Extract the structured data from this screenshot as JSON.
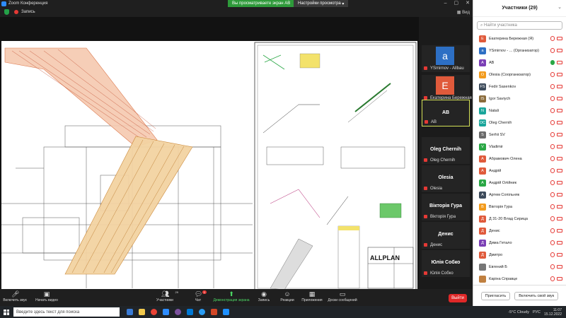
{
  "window": {
    "title": "Zoom Конференция",
    "share_banner": "Вы просматриваете экран AB",
    "view_options": "Настройки просмотра",
    "recording_label": "Запись",
    "view_label": "Вид"
  },
  "gallery": [
    {
      "type": "avatar",
      "letter": "a",
      "color": "#2d6fc4",
      "name": "YSmirnov - Allbau"
    },
    {
      "type": "avatar",
      "letter": "E",
      "color": "#e05a3b",
      "name": "Екатерина Бережная"
    },
    {
      "type": "active",
      "big_name": "AB",
      "name": "AB"
    },
    {
      "type": "name",
      "big_name": "Oleg Chernih",
      "name": "Oleg Chernih"
    },
    {
      "type": "name",
      "big_name": "Olesia",
      "name": "Olesia"
    },
    {
      "type": "name",
      "big_name": "Вікторія Гура",
      "name": "Вікторія Гура"
    },
    {
      "type": "name",
      "big_name": "Денис",
      "name": "Денис"
    },
    {
      "type": "name",
      "big_name": "Юлія Собко",
      "name": "Юлія Собко"
    }
  ],
  "toolbar": {
    "unmute": "Включить звук",
    "start_video": "Начать видео",
    "participants": "Участники",
    "participants_count": "29",
    "chat": "Чат",
    "chat_badge": "1",
    "share": "Демонстрация экрана",
    "record": "Запись",
    "reactions": "Реакции",
    "apps": "Приложения",
    "whiteboard": "Доски сообщений",
    "leave": "Выйти"
  },
  "participants_panel": {
    "title": "Участники (29)",
    "search_placeholder": "Найти участника",
    "items": [
      {
        "initial": "E",
        "color": "#e05a3b",
        "name": "Екатерина Бережная (Я)"
      },
      {
        "initial": "a",
        "color": "#2d6fc4",
        "name": "YSmirnov - ... (Организатор)"
      },
      {
        "initial": "A",
        "color": "#7b3fb5",
        "name": "AB",
        "speaking": true
      },
      {
        "initial": "O",
        "color": "#f29b1d",
        "name": "Olesia (Соорганизатор)"
      },
      {
        "initial": "FS",
        "color": "#3c4a5a",
        "name": "Fedir Sasenkov"
      },
      {
        "initial": "IS",
        "color": "#8a6b3a",
        "name": "Igor Saviych"
      },
      {
        "initial": "N",
        "color": "#19a59a",
        "name": "Natali"
      },
      {
        "initial": "OC",
        "color": "#19a59a",
        "name": "Oleg Chernih"
      },
      {
        "initial": "S",
        "color": "#6a6a6a",
        "name": "Serhii SV"
      },
      {
        "initial": "V",
        "color": "#2aa745",
        "name": "Vladimir"
      },
      {
        "initial": "A",
        "color": "#e05a3b",
        "name": "Абрамович Олена"
      },
      {
        "initial": "А",
        "color": "#e05a3b",
        "name": "Андрій"
      },
      {
        "initial": "А",
        "color": "#2aa745",
        "name": "Андрій Олійник"
      },
      {
        "initial": "A",
        "color": "#3c4a5a",
        "name": "Артем Сопільняк"
      },
      {
        "initial": "В",
        "color": "#f29b1d",
        "name": "Вікторія Гура"
      },
      {
        "initial": "Д",
        "color": "#e05a3b",
        "name": "Д 31-20 Влад Сирица"
      },
      {
        "initial": "Д",
        "color": "#e05a3b",
        "name": "Денис"
      },
      {
        "initial": "Д",
        "color": "#7b3fb5",
        "name": "Дима Гетало"
      },
      {
        "initial": "Д",
        "color": "#e05a3b",
        "name": "Дмитро"
      },
      {
        "initial": "",
        "color": "#777777",
        "name": "Евгений Б"
      },
      {
        "initial": "",
        "color": "#c08040",
        "name": "Каріна Справце"
      }
    ],
    "invite_button": "Пригласить",
    "unmute_self_button": "Включить свой звук"
  },
  "taskbar": {
    "search_placeholder": "Введите здесь текст для поиска",
    "weather": "-5°C  Cloudy",
    "language": "РУС",
    "time": "11:07",
    "date": "15.12.2022"
  },
  "drawing": {
    "brand": "ALLPLAN"
  }
}
